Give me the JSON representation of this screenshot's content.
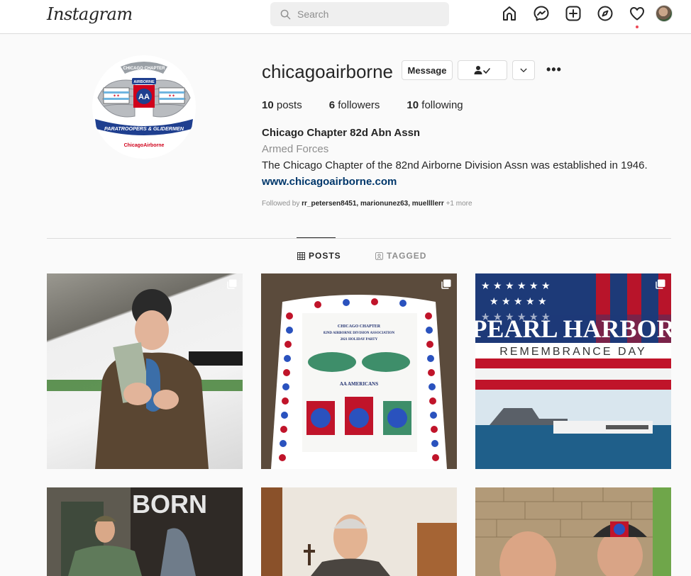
{
  "nav": {
    "logo": "Instagram",
    "search_placeholder": "Search",
    "icons": [
      "home-icon",
      "messenger-icon",
      "new-post-icon",
      "explore-icon",
      "activity-heart-icon"
    ]
  },
  "profile": {
    "username": "chicagoairborne",
    "message_label": "Message",
    "posts_count": "10",
    "posts_label": "posts",
    "followers_count": "6",
    "followers_label": "followers",
    "following_count": "10",
    "following_label": "following",
    "full_name": "Chicago Chapter 82d Abn Assn",
    "category": "Armed Forces",
    "bio": "The Chicago Chapter of the 82nd Airborne Division Assn was established in 1946.",
    "website": "www.chicagoairborne.com",
    "followed_by_prefix": "Followed by",
    "followed_by_names": "rr_petersen8451, marionunez63, muellllerr",
    "followed_by_more": "+1 more",
    "logo_text_top": "CHICAGO CHAPTER",
    "logo_text_airborne": "AIRBORNE",
    "logo_text_banner": "PARATROOPERS & GLIDERMEN",
    "logo_text_bottom": "ChicagoAirborne"
  },
  "tabs": {
    "posts": "POSTS",
    "tagged": "TAGGED"
  },
  "posts": {
    "p2_cake_lines": [
      "CHICAGO CHAPTER",
      "82ND AIRBORNE DIVISION ASSOCIATION",
      "2021 HOLIDAY PARTY"
    ],
    "p2_cake_caption": "AA AMERICANS",
    "p3_title": "PEARL HARBOR",
    "p3_subtitle": "REMEMBRANCE DAY",
    "p4_sign": "BORN"
  },
  "colors": {
    "link": "#00376b",
    "notification_dot": "#ed4956",
    "border": "#dbdbdb"
  }
}
